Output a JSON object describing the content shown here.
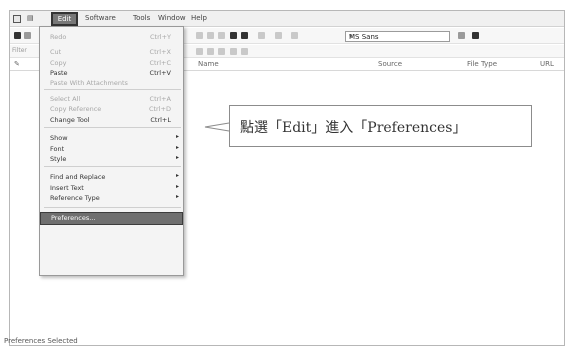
{
  "menubar": {
    "items": [
      "Edit",
      "Software",
      "Tools",
      "Window",
      "Help"
    ]
  },
  "toolbar": {
    "font_select_value": "MS Sans",
    "row2_label": "Filter"
  },
  "columns": [
    "Name",
    "Source",
    "File Type",
    "URL"
  ],
  "edit_menu": {
    "items": [
      {
        "label": "Redo",
        "shortcut": "Ctrl+Y",
        "enabled": false
      },
      {
        "label": "Cut",
        "shortcut": "Ctrl+X",
        "enabled": false
      },
      {
        "label": "Copy",
        "shortcut": "Ctrl+C",
        "enabled": false
      },
      {
        "label": "Paste",
        "shortcut": "Ctrl+V",
        "enabled": true
      },
      {
        "label": "Paste With Attachments",
        "shortcut": "",
        "enabled": false
      },
      {
        "label": "Select All",
        "shortcut": "Ctrl+A",
        "enabled": false
      },
      {
        "label": "Copy Reference",
        "shortcut": "Ctrl+D",
        "enabled": false
      },
      {
        "label": "Change Tool",
        "shortcut": "Ctrl+L",
        "enabled": true
      },
      {
        "label": "Show",
        "shortcut": "",
        "enabled": true,
        "submenu": true
      },
      {
        "label": "Font",
        "shortcut": "",
        "enabled": true,
        "submenu": true
      },
      {
        "label": "Style",
        "shortcut": "",
        "enabled": true,
        "submenu": true
      },
      {
        "label": "Find and Replace",
        "shortcut": "",
        "enabled": true,
        "submenu": true
      },
      {
        "label": "Insert Text",
        "shortcut": "",
        "enabled": true,
        "submenu": true
      },
      {
        "label": "Reference Type",
        "shortcut": "",
        "enabled": true,
        "submenu": true
      },
      {
        "label": "Preferences...",
        "shortcut": "",
        "enabled": true,
        "highlighted": true
      }
    ]
  },
  "callout": {
    "text": "點選「Edit」進入「Preferences」"
  },
  "status": {
    "text": "Preferences Selected"
  },
  "colors": {
    "highlight": "#6f6f6f",
    "border": "#b7b7b7"
  }
}
